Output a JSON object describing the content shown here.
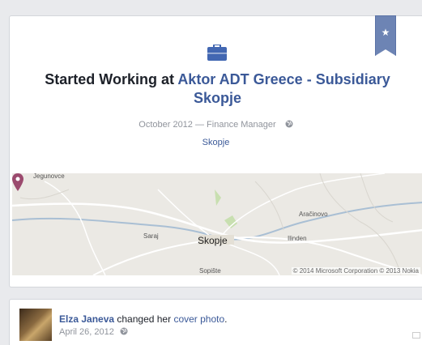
{
  "life_event": {
    "headline_prefix": "Started Working at ",
    "company": "Aktor ADT Greece - Subsidiary Skopje",
    "date": "October 2012",
    "separator": " — ",
    "position": "Finance Manager",
    "place": "Skopje",
    "icon": "briefcase-icon",
    "ribbon_icon": "star-icon",
    "ribbon_star": "★"
  },
  "map": {
    "labels": {
      "jegunovce": "Jegunovce",
      "saraj": "Saraj",
      "skopje": "Skopje",
      "aracinovo": "Aračinovo",
      "ilinden": "Ilinden",
      "sopiste": "Sopište"
    },
    "copyright": "© 2014 Microsoft Corporation © 2013 Nokia"
  },
  "post": {
    "author": "Elza Janeva",
    "action_prefix": " changed her ",
    "action_link": "cover photo",
    "action_suffix": ".",
    "date": "April 26, 2012"
  },
  "colors": {
    "link": "#3b5998",
    "ribbon": "#6d84b4",
    "pin": "#9b4a6e"
  }
}
